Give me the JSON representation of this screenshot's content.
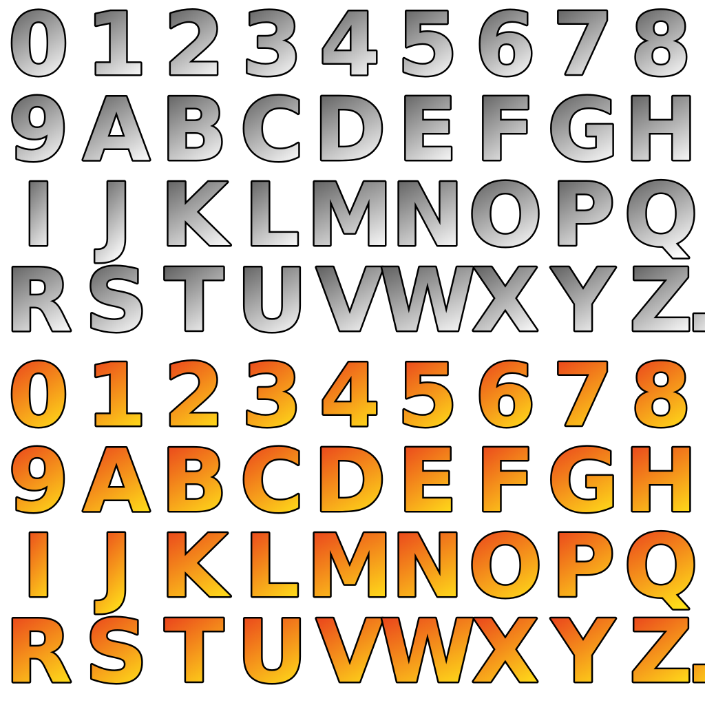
{
  "sets": [
    {
      "name": "silver",
      "gradient": {
        "top": "#4f4f4f",
        "bottom": "#ffffff"
      },
      "rows": [
        [
          "0",
          "1",
          "2",
          "3",
          "4",
          "5",
          "6",
          "7",
          "8"
        ],
        [
          "9",
          "A",
          "B",
          "C",
          "D",
          "E",
          "F",
          "G",
          "H"
        ],
        [
          "I",
          "J",
          "K",
          "L",
          "M",
          "N",
          "O",
          "P",
          "Q"
        ],
        [
          "R",
          "S",
          "T",
          "U",
          "V",
          "W",
          "X",
          "Y",
          "Z",
          "."
        ]
      ]
    },
    {
      "name": "fire",
      "gradient": {
        "top": "#e8341c",
        "bottom": "#ffe11a"
      },
      "rows": [
        [
          "0",
          "1",
          "2",
          "3",
          "4",
          "5",
          "6",
          "7",
          "8"
        ],
        [
          "9",
          "A",
          "B",
          "C",
          "D",
          "E",
          "F",
          "G",
          "H"
        ],
        [
          "I",
          "J",
          "K",
          "L",
          "M",
          "N",
          "O",
          "P",
          "Q"
        ],
        [
          "R",
          "S",
          "T",
          "U",
          "V",
          "W",
          "X",
          "Y",
          "Z",
          "."
        ]
      ]
    }
  ]
}
